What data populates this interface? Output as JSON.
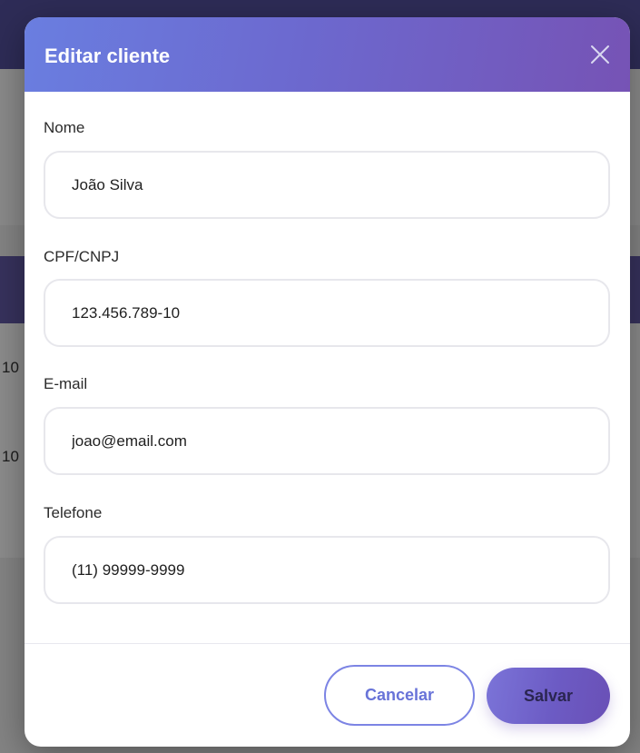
{
  "background": {
    "row_text_1": "10",
    "row_text_2": "10"
  },
  "modal": {
    "title": "Editar cliente",
    "close_icon": "close-icon",
    "fields": [
      {
        "label": "Nome",
        "value": "João Silva"
      },
      {
        "label": "CPF/CNPJ",
        "value": "123.456.789-10"
      },
      {
        "label": "E-mail",
        "value": "joao@email.com"
      },
      {
        "label": "Telefone",
        "value": "(11) 99999-9999"
      }
    ],
    "buttons": {
      "cancel_label": "Cancelar",
      "save_label": "Salvar"
    }
  },
  "colors": {
    "header_gradient_start": "#6a7ee0",
    "header_gradient_end": "#7653b5",
    "cancel_border": "#7c84e4",
    "save_background": "#6c5bc4"
  }
}
